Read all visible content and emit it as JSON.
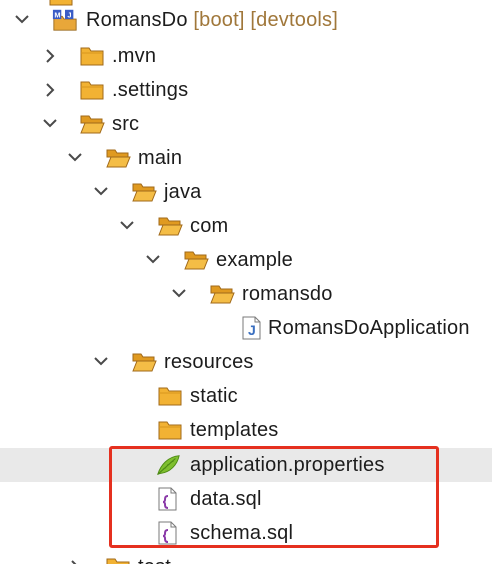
{
  "tree": {
    "project": {
      "name": "RomansDo",
      "decorations": "[boot] [devtools]"
    },
    "items": [
      {
        "label": ".mvn",
        "type": "folder",
        "expanded": false
      },
      {
        "label": ".settings",
        "type": "folder",
        "expanded": false
      },
      {
        "label": "src",
        "type": "folder",
        "expanded": true
      },
      {
        "label": "main",
        "type": "folder",
        "expanded": true
      },
      {
        "label": "java",
        "type": "folder",
        "expanded": true
      },
      {
        "label": "com",
        "type": "folder",
        "expanded": true
      },
      {
        "label": "example",
        "type": "folder",
        "expanded": true
      },
      {
        "label": "romansdo",
        "type": "folder",
        "expanded": true
      },
      {
        "label": "RomansDoApplication",
        "type": "java-file"
      },
      {
        "label": "resources",
        "type": "folder",
        "expanded": true
      },
      {
        "label": "static",
        "type": "folder"
      },
      {
        "label": "templates",
        "type": "folder"
      },
      {
        "label": "application.properties",
        "type": "properties-file",
        "selected": true
      },
      {
        "label": "data.sql",
        "type": "sql-file"
      },
      {
        "label": "schema.sql",
        "type": "sql-file"
      },
      {
        "label": "test",
        "type": "folder",
        "expanded": false
      }
    ]
  },
  "highlight": {
    "color": "#e5301f"
  },
  "icons": {
    "chevron_right": "chevron-right-icon",
    "chevron_down": "chevron-down-icon",
    "folder": "folder-icon",
    "project": "maven-project-icon",
    "java_file": "java-file-icon",
    "properties_file": "properties-file-icon",
    "sql_file": "sql-file-icon"
  }
}
